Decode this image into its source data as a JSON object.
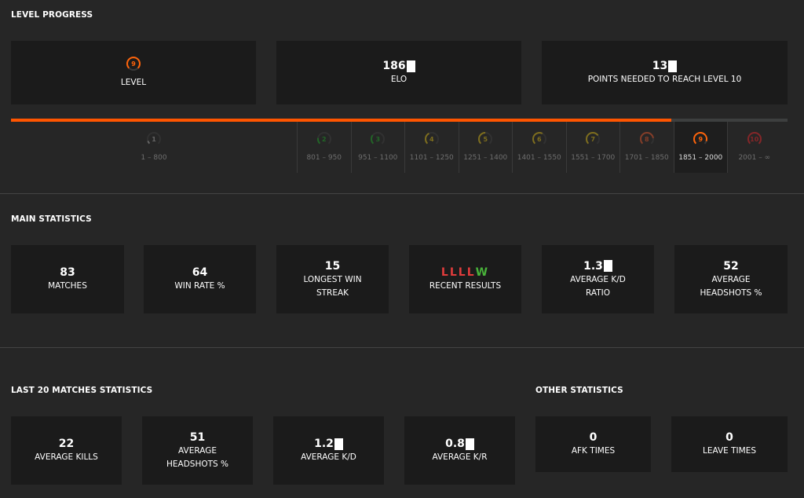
{
  "level_progress": {
    "title": "LEVEL PROGRESS",
    "level_value": "9",
    "level_label": "LEVEL",
    "elo_value": "186",
    "elo_label": "ELO",
    "points_value": "13",
    "points_label": "POINTS NEEDED TO REACH LEVEL 10",
    "progress_fraction": 0.85,
    "levels": [
      {
        "level": "1",
        "range": "1 – 800",
        "color": "#9a9a9a"
      },
      {
        "level": "2",
        "range": "801 – 950",
        "color": "#1f9c28"
      },
      {
        "level": "3",
        "range": "951 – 1100",
        "color": "#1f9c28"
      },
      {
        "level": "4",
        "range": "1101 – 1250",
        "color": "#c7a918"
      },
      {
        "level": "5",
        "range": "1251 – 1400",
        "color": "#c7a918"
      },
      {
        "level": "6",
        "range": "1401 – 1550",
        "color": "#c7a918"
      },
      {
        "level": "7",
        "range": "1551 – 1700",
        "color": "#c7a918"
      },
      {
        "level": "8",
        "range": "1701 – 1850",
        "color": "#d2502a"
      },
      {
        "level": "9",
        "range": "1851 – 2000",
        "color": "#ff6309"
      },
      {
        "level": "10",
        "range": "2001 – ∞",
        "color": "#d2262a"
      }
    ],
    "current_level_index": 8
  },
  "main_statistics": {
    "title": "MAIN STATISTICS",
    "matches_value": "83",
    "matches_label": "MATCHES",
    "winrate_value": "64",
    "winrate_label": "WIN RATE %",
    "streak_value": "15",
    "streak_label": "LONGEST WIN STREAK",
    "recent_results": [
      "L",
      "L",
      "L",
      "L",
      "W"
    ],
    "recent_label": "RECENT RESULTS",
    "kd_value": "1.3",
    "kd_label": "AVERAGE K/D RATIO",
    "hs_value": "52",
    "hs_label": "AVERAGE HEADSHOTS %"
  },
  "last20": {
    "title": "LAST 20 MATCHES STATISTICS",
    "kills_value": "22",
    "kills_label": "AVERAGE KILLS",
    "hs_value": "51",
    "hs_label": "AVERAGE HEADSHOTS %",
    "kd_value": "1.2",
    "kd_label": "AVERAGE K/D",
    "kr_value": "0.8",
    "kr_label": "AVERAGE K/R"
  },
  "other": {
    "title": "OTHER STATISTICS",
    "afk_value": "0",
    "afk_label": "AFK TIMES",
    "leave_value": "0",
    "leave_label": "LEAVE TIMES"
  },
  "colors": {
    "accent": "#ff5500",
    "loss": "#e03c3c",
    "win": "#49b33a"
  }
}
